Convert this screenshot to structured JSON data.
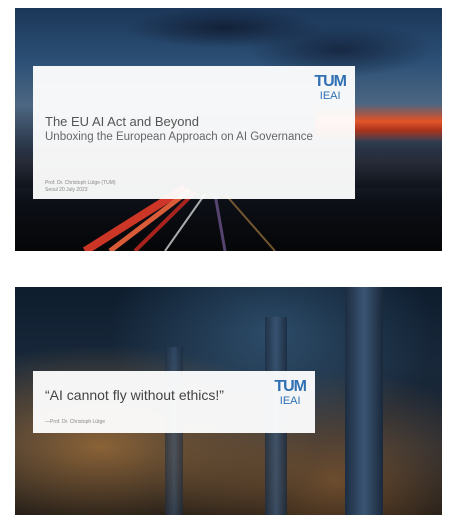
{
  "slides": [
    {
      "title": "The EU AI Act and Beyond",
      "subtitle": "Unboxing the European Approach on AI Governance",
      "author": "Prof. Dr. Christoph Lütge (TUM)",
      "date": "Seoul 20 July 2023",
      "logo": {
        "top": "TUM",
        "bottom": "IEAI"
      }
    },
    {
      "quote": "“AI cannot fly without ethics!”",
      "attribution": "—Prof. Dr. Christoph Lütge",
      "logo": {
        "top": "TUM",
        "bottom": "IEAI"
      }
    }
  ],
  "colors": {
    "logo": "#3070b3",
    "text": "#555555",
    "sunset": "#e2552a"
  }
}
